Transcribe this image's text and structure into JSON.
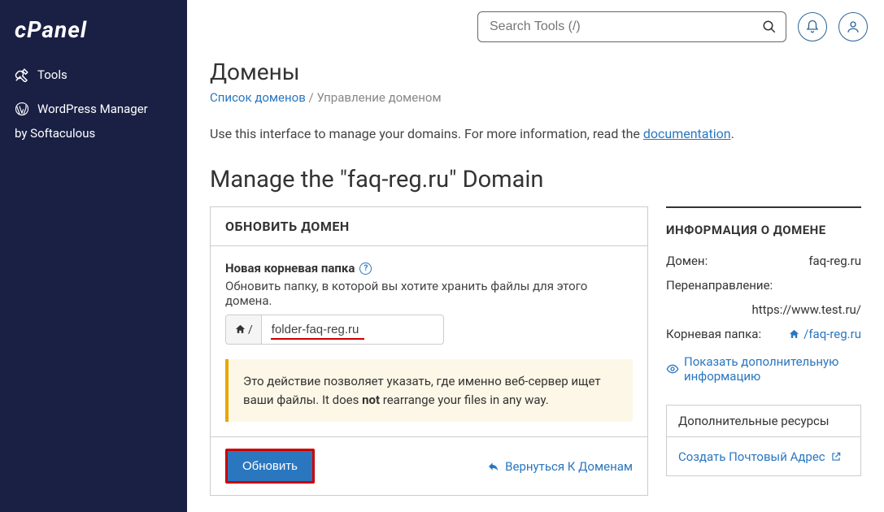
{
  "logo": "cPanel",
  "sidebar": {
    "tools": "Tools",
    "wp_manager": "WordPress Manager",
    "wp_sub": "by Softaculous"
  },
  "search": {
    "placeholder": "Search Tools (/)"
  },
  "page": {
    "title": "Домены",
    "breadcrumb": {
      "list": "Список доменов",
      "sep": "/",
      "current": "Управление доменом"
    },
    "intro_pre": "Use this interface to manage your domains. For more information, read the ",
    "intro_link": "documentation",
    "intro_post": ".",
    "manage_title": "Manage the \"faq-reg.ru\" Domain"
  },
  "update_card": {
    "header": "ОБНОВИТЬ ДОМЕН",
    "field_label": "Новая корневая папка",
    "field_desc": "Обновить папку, в которой вы хотите хранить файлы для этого домена.",
    "input_value": "folder-faq-reg.ru",
    "callout_pre": "Это действие позволяет указать, где именно веб-сервер ищет ваши файлы. It does ",
    "callout_bold": "not",
    "callout_post": " rearrange your files in any way.",
    "submit": "Обновить",
    "back": "Вернуться К Доменам"
  },
  "info": {
    "header": "ИНФОРМАЦИЯ О ДОМЕНЕ",
    "rows": {
      "domain_key": "Домен:",
      "domain_val": "faq-reg.ru",
      "redirect_key": "Перенаправление:",
      "redirect_val": "https://www.test.ru/",
      "root_key": "Корневая папка:",
      "root_val": "/faq-reg.ru"
    },
    "show_more": "Показать дополнительную информацию"
  },
  "resources": {
    "header": "Дополнительные ресурсы",
    "create_mail": "Создать Почтовый Адрес"
  }
}
